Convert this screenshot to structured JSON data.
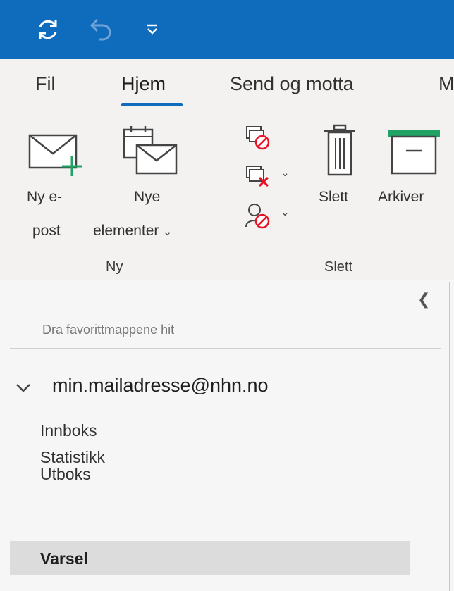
{
  "quick_access": {
    "sync_icon": "sync-icon",
    "undo_icon": "undo-icon",
    "customize_icon": "customize-dropdown-icon"
  },
  "tabs": [
    {
      "label": "Fil"
    },
    {
      "label": "Hjem",
      "active": true
    },
    {
      "label": "Send og motta"
    },
    {
      "label": "M"
    }
  ],
  "ribbon": {
    "groups": {
      "ny": {
        "label": "Ny",
        "new_email": {
          "line1": "Ny e-",
          "line2": "post"
        },
        "new_items": {
          "line1": "Nye",
          "line2": "elementer"
        }
      },
      "slett": {
        "label": "Slett",
        "delete": "Slett",
        "archive": "Arkiver"
      }
    }
  },
  "folder_pane": {
    "favorites_hint": "Dra favorittmappene hit",
    "account": "min.mailadresse@nhn.no",
    "folders": [
      {
        "label": "Innboks"
      },
      {
        "label": "Statistikk"
      },
      {
        "label": "Utboks"
      },
      {
        "label": "Varsel",
        "selected": true
      }
    ]
  },
  "colors": {
    "accent": "#0f6cbd",
    "green": "#21a366",
    "red": "#e81123"
  }
}
